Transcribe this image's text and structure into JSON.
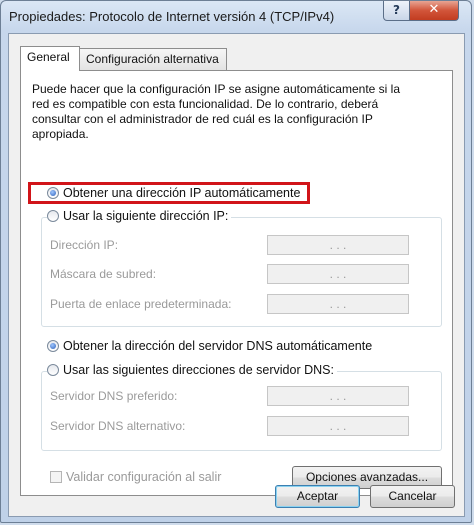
{
  "window": {
    "title": "Propiedades: Protocolo de Internet versión 4 (TCP/IPv4)",
    "help_glyph": "?",
    "close_glyph": "✕"
  },
  "tabs": [
    {
      "label": "General",
      "active": true
    },
    {
      "label": "Configuración alternativa",
      "active": false
    }
  ],
  "intro_text": "Puede hacer que la configuración IP se asigne automáticamente si la red es compatible con esta funcionalidad. De lo contrario, deberá consultar con el administrador de red cuál es la configuración IP apropiada.",
  "ip_mode": {
    "auto_label": "Obtener una dirección IP automáticamente",
    "manual_label": "Usar la siguiente dirección IP:",
    "selected": "auto",
    "highlight_color": "#d11419"
  },
  "ip_fields": [
    {
      "label": "Dirección IP:",
      "value": ". . ."
    },
    {
      "label": "Máscara de subred:",
      "value": ". . ."
    },
    {
      "label": "Puerta de enlace predeterminada:",
      "value": ". . ."
    }
  ],
  "dns_mode": {
    "auto_label": "Obtener la dirección del servidor DNS automáticamente",
    "manual_label": "Usar las siguientes direcciones de servidor DNS:",
    "selected": "auto"
  },
  "dns_fields": [
    {
      "label": "Servidor DNS preferido:",
      "value": ". . ."
    },
    {
      "label": "Servidor DNS alternativo:",
      "value": ". . ."
    }
  ],
  "validate_checkbox": {
    "label": "Validar configuración al salir",
    "checked": false,
    "enabled": false
  },
  "buttons": {
    "advanced": "Opciones avanzadas...",
    "ok": "Aceptar",
    "cancel": "Cancelar"
  }
}
